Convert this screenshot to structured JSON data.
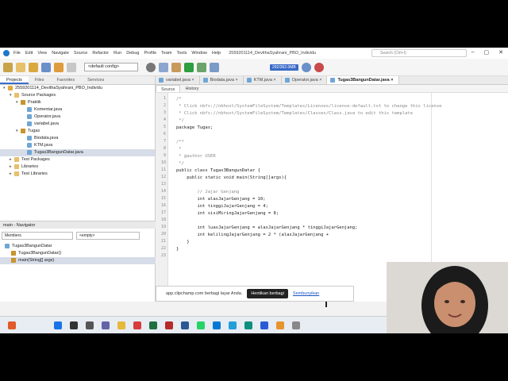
{
  "titlebar": {
    "menu": [
      "File",
      "Edit",
      "View",
      "Navigate",
      "Source",
      "Refactor",
      "Run",
      "Debug",
      "Profile",
      "Team",
      "Tools",
      "Window",
      "Help"
    ],
    "project_title": "2559201114_DevithaSyahrani_PBO_Individu",
    "search_placeholder": "Search (Ctrl+I)"
  },
  "toolbar": {
    "config": "<default config>",
    "memory": "292/362.0MB"
  },
  "left_panel": {
    "tabs": [
      "Projects",
      "Files",
      "Favorites",
      "Services"
    ],
    "tree": [
      {
        "label": "2559201114_DevithaSyahrani_PBO_Individu",
        "level": 0,
        "icon": "project-icon",
        "arrow": "▾"
      },
      {
        "label": "Source Packages",
        "level": 1,
        "icon": "folder-icon",
        "arrow": "▾"
      },
      {
        "label": "Praktik",
        "level": 2,
        "icon": "package-icon",
        "arrow": "▾"
      },
      {
        "label": "Komentar.java",
        "level": 3,
        "icon": "java-file-icon",
        "arrow": ""
      },
      {
        "label": "Operator.java",
        "level": 3,
        "icon": "java-file-icon",
        "arrow": ""
      },
      {
        "label": "variabel.java",
        "level": 3,
        "icon": "java-file-icon",
        "arrow": ""
      },
      {
        "label": "Tugas",
        "level": 2,
        "icon": "package-icon",
        "arrow": "▾"
      },
      {
        "label": "Biodata.java",
        "level": 3,
        "icon": "java-file-icon",
        "arrow": ""
      },
      {
        "label": "KTM.java",
        "level": 3,
        "icon": "java-file-icon",
        "arrow": ""
      },
      {
        "label": "Tugas3BangunDatar.java",
        "level": 3,
        "icon": "java-file-icon",
        "arrow": "",
        "selected": true
      },
      {
        "label": "Test Packages",
        "level": 1,
        "icon": "folder-icon",
        "arrow": "▸"
      },
      {
        "label": "Libraries",
        "level": 1,
        "icon": "folder-icon",
        "arrow": "▸"
      },
      {
        "label": "Test Libraries",
        "level": 1,
        "icon": "folder-icon",
        "arrow": "▸"
      }
    ],
    "navigator_title": "main - Navigator",
    "navigator_filter": "Members",
    "navigator_empty": "<empty>",
    "navigator_items": [
      {
        "label": "Tugas3BangunDatar",
        "level": 0
      },
      {
        "label": "Tugas3BangunDatar()",
        "level": 1
      },
      {
        "label": "main(String[] args)",
        "level": 1,
        "selected": true
      }
    ]
  },
  "editor": {
    "file_tabs": [
      "variabel.java",
      "Biodata.java",
      "KTM.java",
      "Operator.java",
      "Tugas3BangunDatar.java"
    ],
    "active_tab": "Tugas3BangunDatar.java",
    "source_tabs": [
      "Source",
      "History"
    ],
    "code_lines": [
      {
        "n": "1",
        "text": "/*",
        "cls": "cm"
      },
      {
        "n": "2",
        "text": " * Click nbfs://nbhost/SystemFileSystem/Templates/Licenses/license-default.txt to change this license",
        "cls": "cm"
      },
      {
        "n": "3",
        "text": " * Click nbfs://nbhost/SystemFileSystem/Templates/Classes/Class.java to edit this template",
        "cls": "cm"
      },
      {
        "n": "4",
        "text": " */",
        "cls": "cm"
      },
      {
        "n": "5",
        "text": "package Tugas;",
        "cls": ""
      },
      {
        "n": "6",
        "text": "",
        "cls": ""
      },
      {
        "n": "7",
        "text": "/**",
        "cls": "cm"
      },
      {
        "n": "8",
        "text": " *",
        "cls": "cm"
      },
      {
        "n": "9",
        "text": " * @author USER",
        "cls": "cm"
      },
      {
        "n": "10",
        "text": " */",
        "cls": "cm"
      },
      {
        "n": "11",
        "text": "public class Tugas3BangunDatar {",
        "cls": ""
      },
      {
        "n": "12",
        "text": "    public static void main(String[]args){",
        "cls": ""
      },
      {
        "n": "13",
        "text": "",
        "cls": ""
      },
      {
        "n": "14",
        "text": "        // Jajar Genjang",
        "cls": "cm"
      },
      {
        "n": "15",
        "text": "        int alasJajarGenjang = 10;",
        "cls": ""
      },
      {
        "n": "16",
        "text": "        int tinggiJajarGenjang = 4;",
        "cls": ""
      },
      {
        "n": "17",
        "text": "        int sisiMiringJajarGenjang = 8;",
        "cls": ""
      },
      {
        "n": "18",
        "text": "",
        "cls": ""
      },
      {
        "n": "19",
        "text": "        int luasJajarGenjang = alasJajarGenjang * tinggiJajarGenjang;",
        "cls": ""
      },
      {
        "n": "20",
        "text": "        int kelilingJajarGenjang = 2 * (alasJajarGenjang +",
        "cls": ""
      },
      {
        "n": "21",
        "text": "    }",
        "cls": ""
      },
      {
        "n": "22",
        "text": "}",
        "cls": ""
      },
      {
        "n": "23",
        "text": "",
        "cls": ""
      }
    ]
  },
  "share_bar": {
    "message": "app.clipchamp.com berbagi layar Anda.",
    "stop_label": "Hentikan berbagi",
    "hide_label": "Sembunyikan"
  },
  "colors": {
    "accent": "#3a6bc8",
    "taskbar": "#e8ecf3"
  }
}
